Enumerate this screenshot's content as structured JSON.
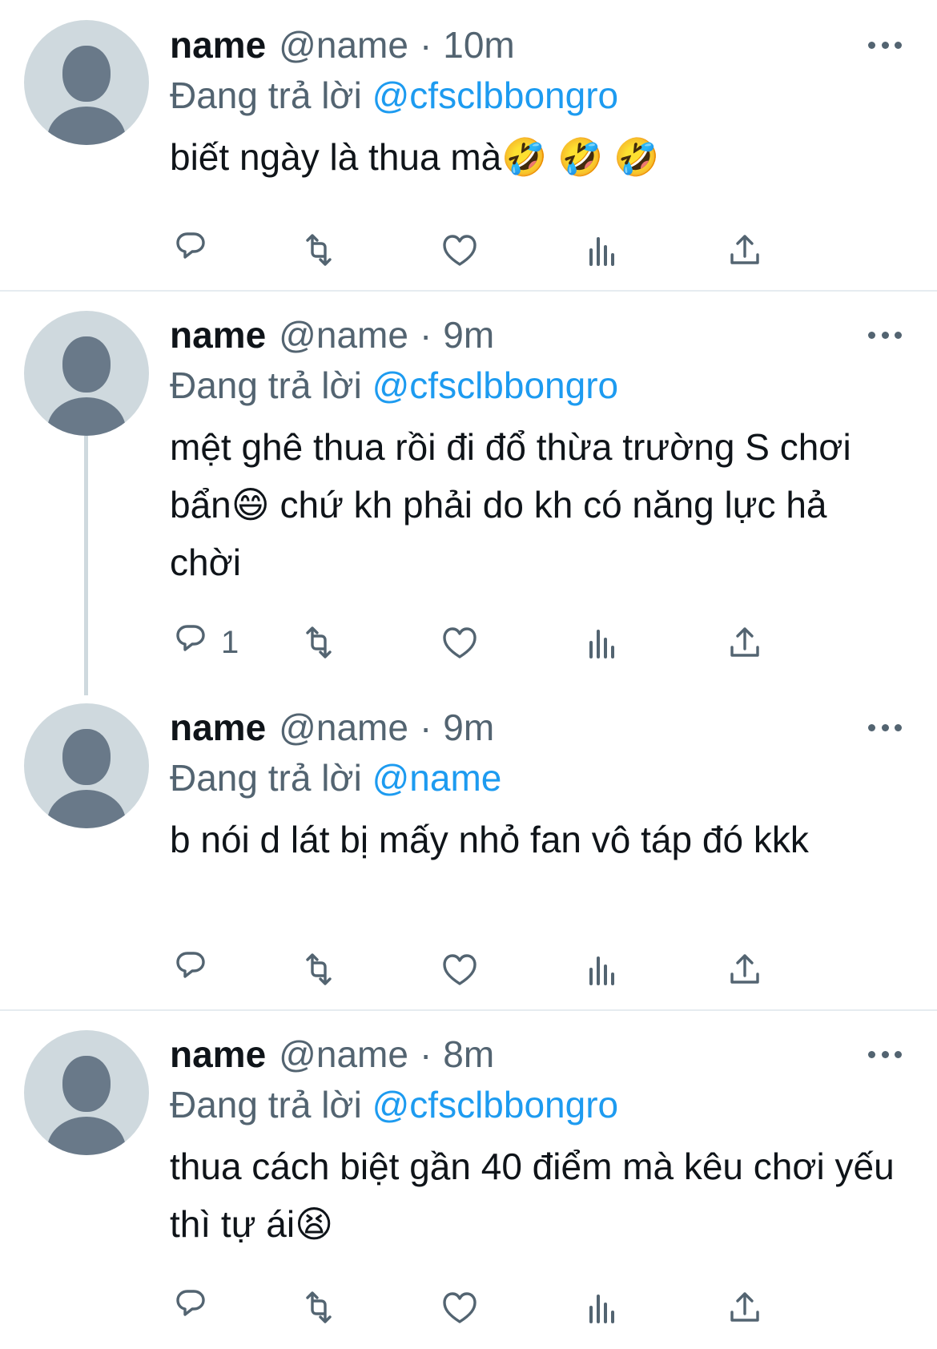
{
  "colors": {
    "link": "#1d9bf0",
    "secondary_text": "#536471",
    "avatar_bg": "#cfd9de"
  },
  "tweets": [
    {
      "display_name": "name",
      "handle": "@name",
      "separator": "·",
      "time": "10m",
      "reply_prefix": "Đang trả lời",
      "reply_to": "@cfsclbbongro",
      "text": "biết ngày là thua mà🤣 🤣 🤣",
      "reply_count": ""
    },
    {
      "display_name": "name",
      "handle": "@name",
      "separator": "·",
      "time": "9m",
      "reply_prefix": "Đang trả lời",
      "reply_to": "@cfsclbbongro",
      "text": "mệt ghê thua rồi đi đổ thừa trường S chơi bẩn😄 chứ kh phải do kh có năng lực hả chời",
      "reply_count": "1"
    },
    {
      "display_name": "name",
      "handle": "@name",
      "separator": "·",
      "time": "9m",
      "reply_prefix": "Đang trả lời",
      "reply_to": "@name",
      "text": "b nói d lát bị mấy nhỏ fan vô táp đó kkk",
      "reply_count": ""
    },
    {
      "display_name": "name",
      "handle": "@name",
      "separator": "·",
      "time": "8m",
      "reply_prefix": "Đang trả lời",
      "reply_to": "@cfsclbbongro",
      "text": "thua cách biệt gần 40 điểm mà kêu chơi yếu thì tự ái😫",
      "reply_count": ""
    }
  ]
}
